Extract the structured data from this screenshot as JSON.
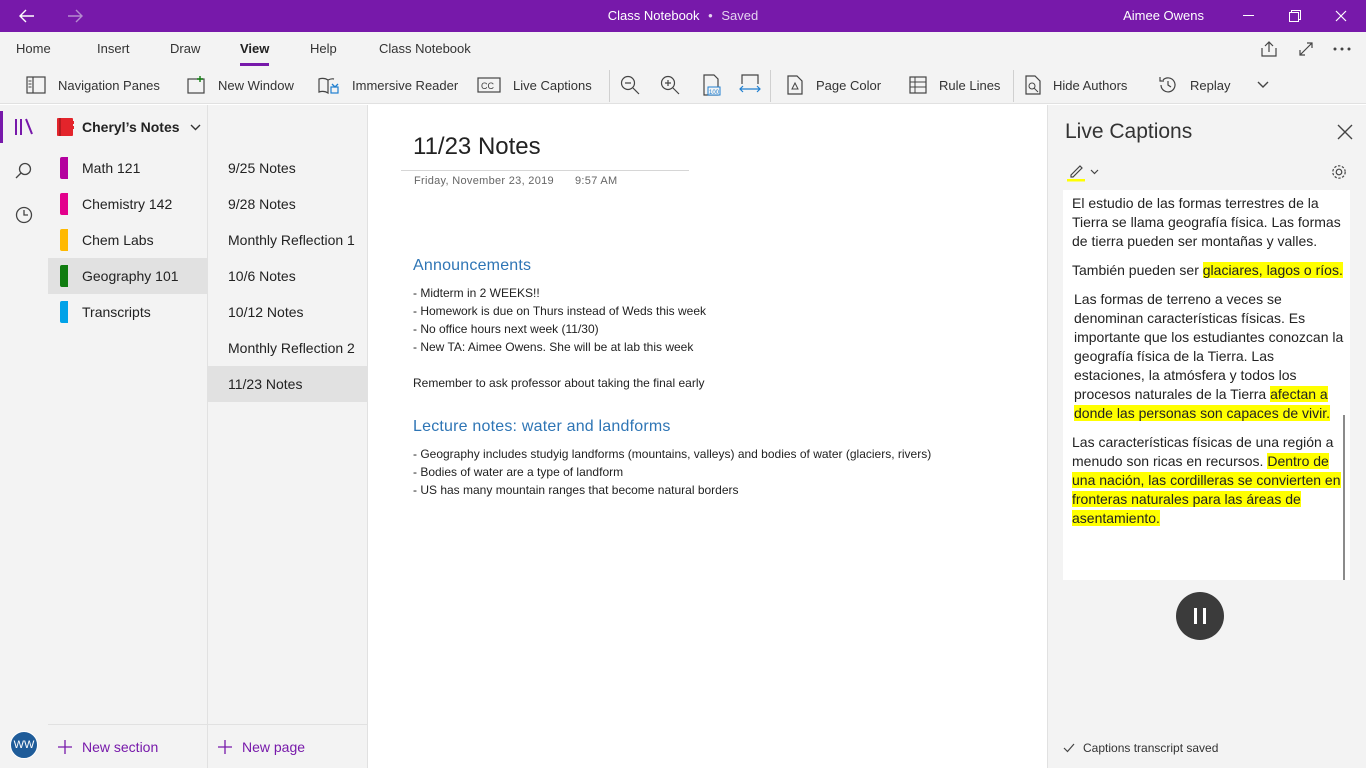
{
  "titlebar": {
    "title": "Class Notebook",
    "separator": "•",
    "status": "Saved",
    "user": "Aimee Owens",
    "icons": [
      "back-arrow-icon",
      "forward-arrow-icon",
      "minimize-icon",
      "maximize-icon",
      "close-icon"
    ]
  },
  "tabs": [
    "Home",
    "Insert",
    "Draw",
    "View",
    "Help",
    "Class Notebook"
  ],
  "active_tab": "View",
  "ribbon": {
    "navigation_panes": "Navigation Panes",
    "new_window": "New Window",
    "immersive_reader": "Immersive Reader",
    "live_captions": "Live Captions",
    "page_color": "Page Color",
    "rule_lines": "Rule Lines",
    "hide_authors": "Hide Authors",
    "replay": "Replay"
  },
  "notebook": {
    "name": "Cheryl’s Notes",
    "color": "#e3242b"
  },
  "sections": [
    {
      "label": "Math 121",
      "color": "#b4009e"
    },
    {
      "label": "Chemistry 142",
      "color": "#e3008c"
    },
    {
      "label": "Chem Labs",
      "color": "#ffb900"
    },
    {
      "label": "Geography 101",
      "color": "#107c10"
    },
    {
      "label": "Transcripts",
      "color": "#00a2e8"
    }
  ],
  "selected_section": "Geography 101",
  "pages": [
    "9/25 Notes",
    "9/28 Notes",
    "Monthly Reflection 1",
    "10/6 Notes",
    "10/12 Notes",
    "Monthly Reflection 2",
    "11/23 Notes"
  ],
  "selected_page": "11/23 Notes",
  "new_section": "New section",
  "new_page": "New page",
  "avatar_initials": "WW",
  "page": {
    "title": "11/23 Notes",
    "date": "Friday, November 23, 2019",
    "time": "9:57 AM",
    "heading1": "Announcements",
    "announcements": [
      "- Midterm in 2 WEEKS!!",
      "- Homework is due on Thurs instead of Weds this week",
      "- No office hours next week (11/30)",
      "- New TA: Aimee Owens. She will be at lab this week"
    ],
    "reminder": "Remember to ask professor about taking the final early",
    "heading2": "Lecture notes: water and landforms",
    "lecture": [
      "- Geography includes studyig landforms (mountains, valleys) and bodies of water (glaciers, rivers)",
      "- Bodies of water are a type of landform",
      "- US has many mountain ranges that become natural borders"
    ]
  },
  "captions": {
    "title": "Live Captions",
    "p1": "El estudio de las formas terrestres de la Tierra se llama geografía física. Las formas de tierra pueden ser montañas y valles.",
    "p2_plain": "También pueden ser ",
    "p2_hl": "glaciares, lagos o ríos.",
    "p3_plain": "Las formas de terreno a veces se denominan características físicas. Es importante que los estudiantes conozcan la geografía física de la Tierra. Las estaciones, la atmósfera y todos los procesos naturales de la Tierra ",
    "p3_hl": "afectan a donde las personas son capaces de vivir.",
    "p4_plain": "Las características físicas de una región a menudo son ricas en recursos. ",
    "p4_hl": "Dentro de una nación, las cordilleras se convierten en fronteras naturales para las áreas de asentamiento.",
    "status": "Captions transcript saved",
    "highlight_color": "#ffff00"
  },
  "colors": {
    "accent": "#7719aa",
    "heading": "#2e75b5"
  }
}
